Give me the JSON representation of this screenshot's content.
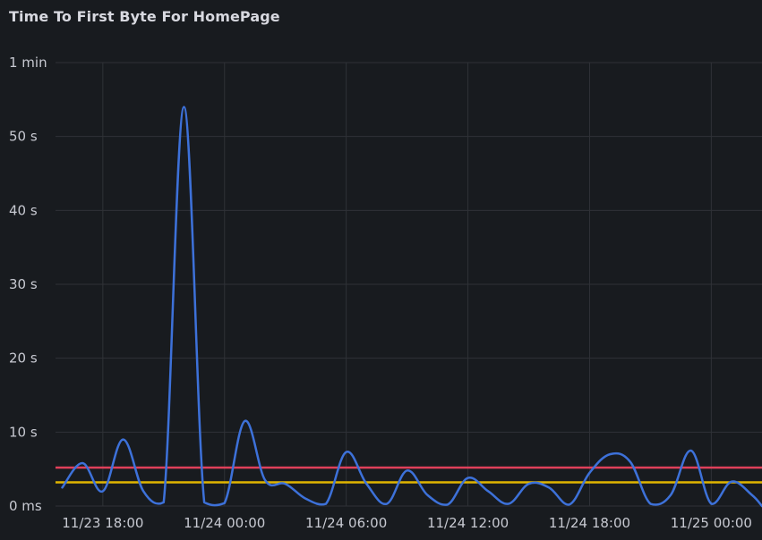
{
  "panel": {
    "title": "Time To First Byte For HomePage"
  },
  "colors": {
    "background": "#181b1f",
    "grid": "#2f3237",
    "series": "#3d71d9",
    "threshold_red": "#e0405a",
    "threshold_yellow": "#e0b400"
  },
  "chart_data": {
    "type": "line",
    "title": "Time To First Byte For HomePage",
    "xlabel": "",
    "ylabel": "",
    "x_start": "11/23 15:40",
    "x_end": "11/25 02:30",
    "ylim": [
      0,
      60
    ],
    "yticks": [
      {
        "value": 0,
        "label": "0 ms"
      },
      {
        "value": 10,
        "label": "10 s"
      },
      {
        "value": 20,
        "label": "20 s"
      },
      {
        "value": 30,
        "label": "30 s"
      },
      {
        "value": 40,
        "label": "40 s"
      },
      {
        "value": 50,
        "label": "50 s"
      },
      {
        "value": 60,
        "label": "1 min"
      }
    ],
    "xticks": [
      {
        "value": "11/23 18:00",
        "label": "11/23 18:00"
      },
      {
        "value": "11/24 00:00",
        "label": "11/24 00:00"
      },
      {
        "value": "11/24 06:00",
        "label": "11/24 06:00"
      },
      {
        "value": "11/24 12:00",
        "label": "11/24 12:00"
      },
      {
        "value": "11/24 18:00",
        "label": "11/24 18:00"
      },
      {
        "value": "11/25 00:00",
        "label": "11/25 00:00"
      }
    ],
    "grid": true,
    "thresholds": [
      {
        "value": 5.2,
        "color": "#e0405a"
      },
      {
        "value": 3.2,
        "color": "#e0b400"
      }
    ],
    "series": [
      {
        "color": "#3d71d9",
        "x": [
          "11/23 16:00",
          "11/23 17:00",
          "11/23 18:00",
          "11/23 19:00",
          "11/23 20:00",
          "11/23 21:00",
          "11/23 22:00",
          "11/23 23:00",
          "11/24 00:00",
          "11/24 01:00",
          "11/24 02:00",
          "11/24 03:00",
          "11/24 04:00",
          "11/24 05:00",
          "11/24 06:00",
          "11/24 07:00",
          "11/24 08:00",
          "11/24 09:00",
          "11/24 10:00",
          "11/24 11:00",
          "11/24 12:00",
          "11/24 13:00",
          "11/24 14:00",
          "11/24 15:00",
          "11/24 16:00",
          "11/24 17:00",
          "11/24 18:00",
          "11/24 19:00",
          "11/24 20:00",
          "11/24 21:00",
          "11/24 22:00",
          "11/24 23:00",
          "11/25 00:00",
          "11/25 01:00",
          "11/25 02:00",
          "11/25 02:30"
        ],
        "y": [
          2.5,
          5.8,
          2.0,
          9.0,
          2.0,
          0.5,
          54.0,
          0.5,
          0.4,
          11.5,
          3.5,
          3.0,
          1.0,
          0.3,
          7.3,
          3.0,
          0.3,
          4.8,
          1.5,
          0.2,
          3.8,
          2.0,
          0.3,
          3.0,
          2.5,
          0.2,
          4.5,
          7.0,
          6.0,
          0.3,
          1.5,
          7.5,
          0.3,
          3.3,
          1.5,
          0.0
        ]
      }
    ]
  }
}
